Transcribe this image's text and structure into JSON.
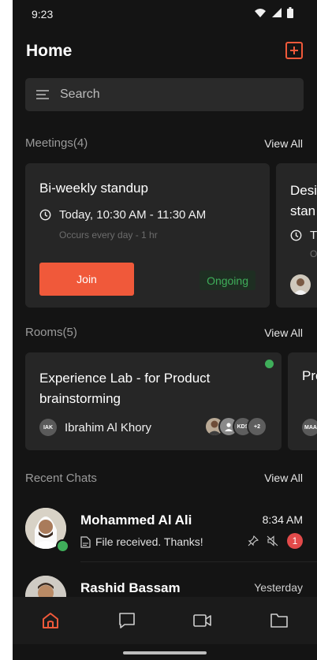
{
  "status_bar": {
    "time": "9:23"
  },
  "header": {
    "title": "Home"
  },
  "search": {
    "placeholder": "Search"
  },
  "meetings": {
    "section_label": "Meetings",
    "count": "(4)",
    "view_all_label": "View All",
    "cards": [
      {
        "title": "Bi-weekly standup",
        "time": "Today, 10:30 AM - 11:30 AM",
        "recurrence": "Occurs every day - 1 hr",
        "join_label": "Join",
        "status": "Ongoing"
      },
      {
        "title_line1": "Desi",
        "title_line2": "stan",
        "time": "T",
        "recurrence": "O"
      }
    ]
  },
  "rooms": {
    "section_label": "Rooms",
    "count": "(5)",
    "view_all_label": "View All",
    "cards": [
      {
        "title": "Experience Lab - for Product brainstorming",
        "owner_initials": "IAK",
        "owner_name": "Ibrahim Al Khory",
        "member_initials": "KDS",
        "extra_members": "+2"
      },
      {
        "title": "Proc",
        "owner_initials": "MAA"
      }
    ]
  },
  "recent_chats": {
    "section_label": "Recent Chats",
    "view_all_label": "View All",
    "items": [
      {
        "name": "Mohammed Al Ali",
        "time": "8:34 AM",
        "preview": "File received. Thanks!",
        "unread": "1",
        "online": true
      },
      {
        "name": "Rashid Bassam",
        "time": "Yesterday"
      }
    ]
  },
  "colors": {
    "accent": "#f0593a",
    "online": "#3fae5a",
    "background": "#141414",
    "card": "#262626"
  },
  "icons": {
    "nav": [
      "home-icon",
      "chat-icon",
      "video-icon",
      "folder-icon"
    ]
  }
}
